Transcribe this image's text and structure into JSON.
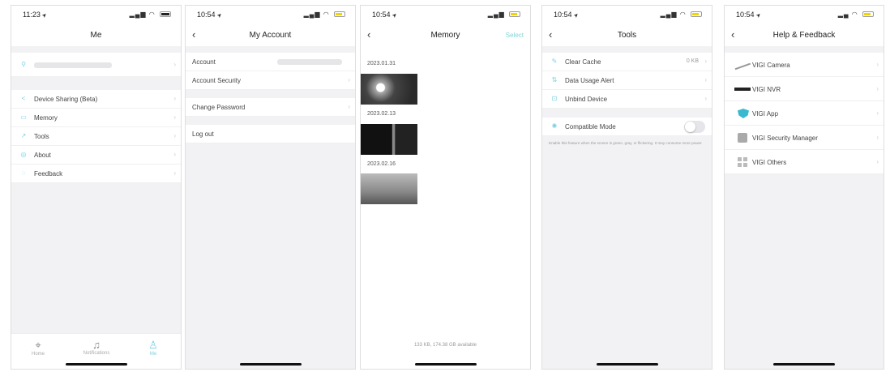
{
  "s1": {
    "time": "11:23",
    "title": "Me",
    "items": [
      {
        "label": "Device Sharing (Beta)"
      },
      {
        "label": "Memory"
      },
      {
        "label": "Tools"
      },
      {
        "label": "About"
      },
      {
        "label": "Feedback"
      }
    ],
    "tabs": [
      {
        "label": "Home",
        "icon": "camera-icon"
      },
      {
        "label": "Notifications",
        "icon": "bell-icon"
      },
      {
        "label": "Me",
        "icon": "person-icon"
      }
    ]
  },
  "s2": {
    "time": "10:54",
    "title": "My Account",
    "account_label": "Account",
    "account_security": "Account Security",
    "change_password": "Change Password",
    "log_out": "Log out"
  },
  "s3": {
    "time": "10:54",
    "title": "Memory",
    "select": "Select",
    "dates": [
      "2023.01.31",
      "2023.02.13",
      "2023.02.16"
    ],
    "storage": "133 KB, 174.38 GB available"
  },
  "s4": {
    "time": "10:54",
    "title": "Tools",
    "clear_cache": "Clear Cache",
    "clear_cache_value": "0 KB",
    "data_usage": "Data Usage Alert",
    "unbind": "Unbind Device",
    "compatible": "Compatible Mode",
    "note": "Enable this feature when the screen is green, gray, or flickering. It may consume more power."
  },
  "s5": {
    "time": "10:54",
    "title": "Help & Feedback",
    "items": [
      {
        "label": "VIGI Camera",
        "icon": "camera-icon"
      },
      {
        "label": "VIGI NVR",
        "icon": "nvr-icon"
      },
      {
        "label": "VIGI App",
        "icon": "app-icon"
      },
      {
        "label": "VIGI Security Manager",
        "icon": "security-manager-icon"
      },
      {
        "label": "VIGI Others",
        "icon": "grid-icon"
      }
    ]
  },
  "colors": {
    "accent": "#7fcfe0",
    "background": "#f2f2f4"
  }
}
